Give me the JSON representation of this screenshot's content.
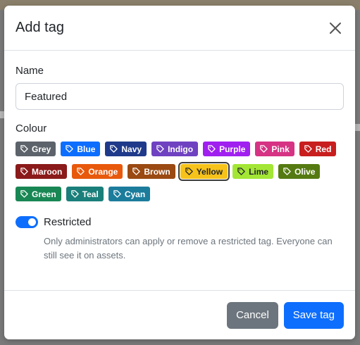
{
  "dialog": {
    "title": "Add tag",
    "close_icon": "close-icon"
  },
  "name_field": {
    "label": "Name",
    "value": "Featured"
  },
  "colour": {
    "label": "Colour",
    "tag_icon": "tag-icon",
    "selected": "Yellow",
    "options": [
      {
        "label": "Grey",
        "color": "#5c636a"
      },
      {
        "label": "Blue",
        "color": "#0d6efd"
      },
      {
        "label": "Navy",
        "color": "#1f3a8a"
      },
      {
        "label": "Indigo",
        "color": "#6f42c1"
      },
      {
        "label": "Purple",
        "color": "#a020f0"
      },
      {
        "label": "Pink",
        "color": "#d63384"
      },
      {
        "label": "Red",
        "color": "#c81e1e"
      },
      {
        "label": "Maroon",
        "color": "#8b1a1a"
      },
      {
        "label": "Orange",
        "color": "#e8590c"
      },
      {
        "label": "Brown",
        "color": "#9a4a12"
      },
      {
        "label": "Yellow",
        "color": "#f7c31a"
      },
      {
        "label": "Lime",
        "color": "#a3e635"
      },
      {
        "label": "Olive",
        "color": "#557a12"
      },
      {
        "label": "Green",
        "color": "#198754"
      },
      {
        "label": "Teal",
        "color": "#1a7f7a"
      },
      {
        "label": "Cyan",
        "color": "#1c7c9c"
      }
    ]
  },
  "restricted": {
    "label": "Restricted",
    "enabled": true,
    "help": "Only administrators can apply or remove a restricted tag. Everyone can still see it on assets."
  },
  "footer": {
    "cancel_label": "Cancel",
    "save_label": "Save tag"
  }
}
